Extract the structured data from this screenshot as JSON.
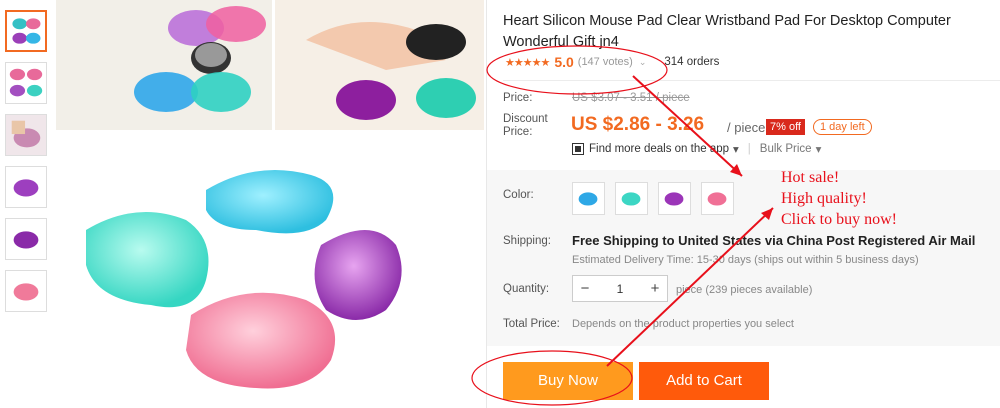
{
  "product": {
    "title": "Heart Silicon Mouse Pad Clear Wristband Pad For Desktop Computer Wonderful Gift jn4",
    "stars": "★★★★★",
    "rating": "5.0",
    "votes": "(147 votes)",
    "votes_chevron": "⌄",
    "orders": "314 orders"
  },
  "price": {
    "label": "Price:",
    "original": "US $3.07 - 3.51 / piece",
    "discount_label_1": "Discount",
    "discount_label_2": "Price:",
    "current": "US $2.86 - 3.26",
    "unit": "/ piece",
    "off_badge": "7% off",
    "time_badge": "1 day left"
  },
  "deals": {
    "find_more": "Find more deals on the app",
    "find_more_chevron": "▾",
    "bulk_price": "Bulk Price",
    "bulk_chevron": "▾"
  },
  "options": {
    "color_label": "Color:",
    "colors": [
      "blue",
      "green",
      "purple",
      "pink"
    ],
    "shipping_label": "Shipping:",
    "shipping_main": "Free Shipping to United States via China Post Registered Air Mail",
    "shipping_sub": "Estimated Delivery Time: 15-30 days (ships out within 5 business days)",
    "quantity_label": "Quantity:",
    "quantity_minus": "−",
    "quantity_value": "1",
    "quantity_plus": "+",
    "quantity_avail": "piece (239 pieces available)",
    "total_label": "Total Price:",
    "total_note": "Depends on the product properties you select"
  },
  "actions": {
    "buy_now": "Buy Now",
    "add_to_cart": "Add to Cart"
  },
  "annotation": {
    "line1": "Hot sale!",
    "line2": "High quality!",
    "line3": "Click to buy now!"
  },
  "colors": {
    "accent": "#f26a21",
    "annotation_red": "#e8101b",
    "buy_now_bg": "#ff9a1e",
    "cart_bg": "#ff5a0b",
    "off_badge_bg": "#d9291c"
  }
}
